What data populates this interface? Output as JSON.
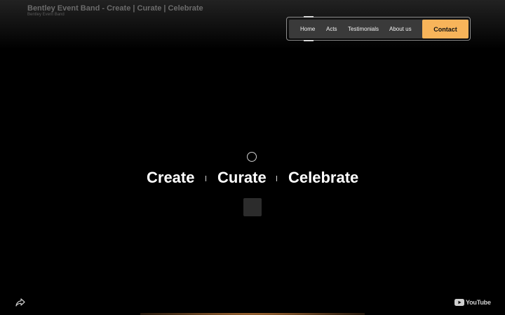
{
  "video": {
    "title": "Bentley Event Band - Create | Curate | Celebrate",
    "channel": "Bentley Event Band"
  },
  "nav": {
    "items": [
      {
        "label": "Home"
      },
      {
        "label": "Acts"
      },
      {
        "label": "Testimonials"
      },
      {
        "label": "About us"
      }
    ],
    "contact_label": "Contact"
  },
  "hero": {
    "words": [
      "Create",
      "Curate",
      "Celebrate"
    ]
  },
  "footer": {
    "youtube_label": "YouTube"
  },
  "colors": {
    "accent": "#f7b45a",
    "background": "#000000",
    "nav_background": "#3a3a3a"
  },
  "icons": {
    "share": "share-icon",
    "youtube": "youtube-logo-icon",
    "loading": "loading-spinner-icon"
  }
}
